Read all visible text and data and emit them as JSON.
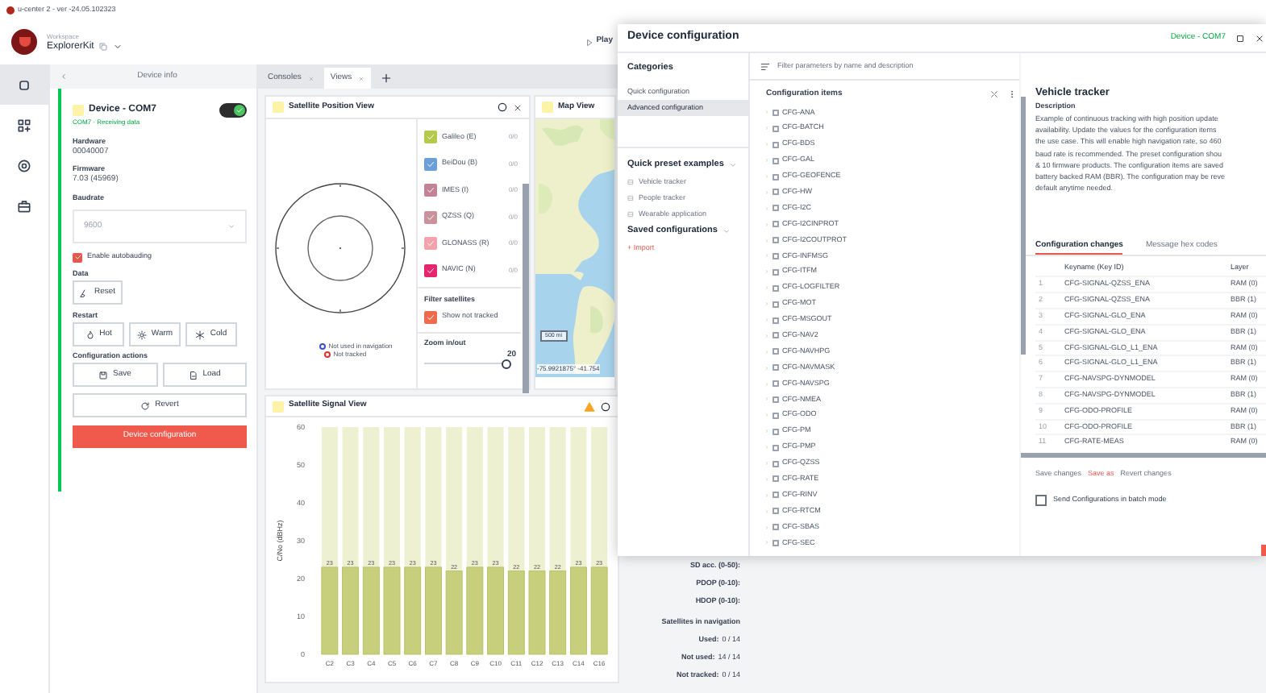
{
  "app": {
    "title": "u-center 2 - ver -24.05.102323",
    "workspace_label": "Workspace",
    "workspace": "ExplorerKit",
    "play": "Play"
  },
  "rail": [
    {
      "selected": true
    },
    {
      "selected": false
    },
    {
      "selected": false
    },
    {
      "selected": false
    }
  ],
  "device_info": {
    "title": "Device info",
    "device": "Device - COM7",
    "connected": true,
    "status": "COM7 · Receiving data",
    "hardware_label": "Hardware",
    "hardware": "00040007",
    "firmware_label": "Firmware",
    "firmware": "7.03 (45969)",
    "baudrate_label": "Baudrate",
    "baudrate": "9600",
    "autobauding": {
      "label": "Enable autobauding",
      "checked": true
    },
    "data_label": "Data",
    "reset": "Reset",
    "restart_label": "Restart",
    "restart": [
      "Hot",
      "Warm",
      "Cold"
    ],
    "actions_label": "Configuration actions",
    "save": "Save",
    "load": "Load",
    "revert": "Revert",
    "configure": "Device configuration"
  },
  "tabs": [
    {
      "label": "Consoles",
      "selected": false
    },
    {
      "label": "Views",
      "selected": true
    }
  ],
  "position_view": {
    "title": "Satellite Position View",
    "constellations": [
      {
        "label": "Galileo (E)",
        "count": "0/0",
        "checked": true,
        "color": "#b5c94a"
      },
      {
        "label": "BeiDou (B)",
        "count": "0/0",
        "checked": true,
        "color": "#6a9fd8"
      },
      {
        "label": "IMES (I)",
        "count": "0/0",
        "checked": true,
        "color": "#c48296"
      },
      {
        "label": "QZSS (Q)",
        "count": "0/0",
        "checked": true,
        "color": "#c9929c"
      },
      {
        "label": "GLONASS (R)",
        "count": "0/0",
        "checked": true,
        "color": "#f2a2ab"
      },
      {
        "label": "NAVIC (N)",
        "count": "0/0",
        "checked": true,
        "color": "#e6256f"
      }
    ],
    "filter_title": "Filter satellites",
    "show_not_tracked": {
      "label": "Show not tracked",
      "checked": true
    },
    "zoom_label": "Zoom in/out",
    "zoom_value": "20",
    "zoom": {
      "level": 1
    },
    "legend": [
      {
        "label": "Not used in navigation",
        "color": "#3b4fd6"
      },
      {
        "label": "Not tracked",
        "color": "#e03131"
      }
    ]
  },
  "map_view": {
    "title": "Map View",
    "scale": "500 mi",
    "coordinates": "-75.9921875° -41.754"
  },
  "signal_view": {
    "title": "Satellite Signal View",
    "chart_data": {
      "type": "bar",
      "ylabel": "C/No (dBHz)",
      "categories": [
        "C2",
        "C3",
        "C4",
        "C5",
        "C6",
        "C7",
        "C8",
        "C9",
        "C10",
        "C11",
        "C12",
        "C13",
        "C14",
        "C16"
      ],
      "values": [
        23,
        23,
        23,
        23,
        23,
        23,
        22,
        23,
        23,
        22,
        22,
        22,
        23,
        23
      ],
      "ylim": [
        0,
        60
      ],
      "yticks": [
        0,
        10,
        20,
        30,
        40,
        50,
        60
      ],
      "data_labels": true
    }
  },
  "stats": {
    "lines": [
      "SD acc. (0-50):",
      "PDOP (0-10):",
      "HDOP (0-10):"
    ],
    "heading": "Satellites in navigation",
    "counts": [
      {
        "label": "Used:",
        "value": "0 / 14"
      },
      {
        "label": "Not used:",
        "value": "14 / 14"
      },
      {
        "label": "Not tracked:",
        "value": "0 / 14"
      }
    ]
  },
  "dialog": {
    "title": "Device configuration",
    "device": "Device - COM7",
    "categories_title": "Categories",
    "categories": [
      {
        "label": "Quick configuration",
        "selected": false
      },
      {
        "label": "Advanced configuration",
        "selected": true
      }
    ],
    "presets_title": "Quick preset examples",
    "presets": [
      "Vehicle tracker",
      "People tracker",
      "Wearable application"
    ],
    "saved_title": "Saved configurations",
    "import": "+ Import",
    "filter_placeholder": "Filter parameters by name and description",
    "items_title": "Configuration items",
    "items": [
      {
        "label": "CFG-ANA",
        "checked": false
      },
      {
        "label": "CFG-BATCH",
        "checked": false
      },
      {
        "label": "CFG-BDS",
        "checked": false
      },
      {
        "label": "CFG-GAL",
        "checked": false
      },
      {
        "label": "CFG-GEOFENCE",
        "checked": false
      },
      {
        "label": "CFG-HW",
        "checked": false
      },
      {
        "label": "CFG-I2C",
        "checked": false
      },
      {
        "label": "CFG-I2CINPROT",
        "checked": false
      },
      {
        "label": "CFG-I2COUTPROT",
        "checked": false
      },
      {
        "label": "CFG-INFMSG",
        "checked": false
      },
      {
        "label": "CFG-ITFM",
        "checked": false
      },
      {
        "label": "CFG-LOGFILTER",
        "checked": false
      },
      {
        "label": "CFG-MOT",
        "checked": false
      },
      {
        "label": "CFG-MSGOUT",
        "checked": false
      },
      {
        "label": "CFG-NAV2",
        "checked": false
      },
      {
        "label": "CFG-NAVHPG",
        "checked": false
      },
      {
        "label": "CFG-NAVMASK",
        "checked": false
      },
      {
        "label": "CFG-NAVSPG",
        "checked": false
      },
      {
        "label": "CFG-NMEA",
        "checked": false
      },
      {
        "label": "CFG-ODO",
        "checked": false
      },
      {
        "label": "CFG-PM",
        "checked": false
      },
      {
        "label": "CFG-PMP",
        "checked": false
      },
      {
        "label": "CFG-QZSS",
        "checked": false
      },
      {
        "label": "CFG-RATE",
        "checked": false
      },
      {
        "label": "CFG-RINV",
        "checked": false
      },
      {
        "label": "CFG-RTCM",
        "checked": false
      },
      {
        "label": "CFG-SBAS",
        "checked": false
      },
      {
        "label": "CFG-SEC",
        "checked": false
      }
    ],
    "detail_title": "Vehicle tracker",
    "description_label": "Description",
    "description_lines": [
      "Example of continuous tracking with high position update",
      "availability. Update the values for the configuration items",
      "the use case. This will enable high navigation rate, so 460",
      "baud rate is recommended. The preset configuration shou",
      "& 10 firmware products. The configuration items are saved",
      "battery backed RAM (BBR). The configuration may be reve",
      "default anytime needed."
    ],
    "detail_tabs": [
      {
        "label": "Configuration changes",
        "selected": true
      },
      {
        "label": "Message hex codes",
        "selected": false
      }
    ],
    "columns": [
      "Keyname (Key ID)",
      "Layer"
    ],
    "changes": [
      {
        "index": "1",
        "key": "CFG-SIGNAL-QZSS_ENA",
        "layer": "RAM (0)"
      },
      {
        "index": "2",
        "key": "CFG-SIGNAL-QZSS_ENA",
        "layer": "BBR (1)"
      },
      {
        "index": "3",
        "key": "CFG-SIGNAL-GLO_ENA",
        "layer": "RAM (0)"
      },
      {
        "index": "4",
        "key": "CFG-SIGNAL-GLO_ENA",
        "layer": "BBR (1)"
      },
      {
        "index": "5",
        "key": "CFG-SIGNAL-GLO_L1_ENA",
        "layer": "RAM (0)"
      },
      {
        "index": "6",
        "key": "CFG-SIGNAL-GLO_L1_ENA",
        "layer": "BBR (1)"
      },
      {
        "index": "7",
        "key": "CFG-NAVSPG-DYNMODEL",
        "layer": "RAM (0)"
      },
      {
        "index": "8",
        "key": "CFG-NAVSPG-DYNMODEL",
        "layer": "BBR (1)"
      },
      {
        "index": "9",
        "key": "CFG-ODO-PROFILE",
        "layer": "RAM (0)"
      },
      {
        "index": "10",
        "key": "CFG-ODO-PROFILE",
        "layer": "BBR (1)"
      },
      {
        "index": "11",
        "key": "CFG-RATE-MEAS",
        "layer": "RAM (0)"
      }
    ],
    "save_changes": {
      "label": "Save changes",
      "disabled": true
    },
    "save_as": "Save as",
    "revert_changes": {
      "label": "Revert changes",
      "disabled": true
    },
    "batch": {
      "label": "Send Configurations in batch mode",
      "checked": false
    }
  }
}
